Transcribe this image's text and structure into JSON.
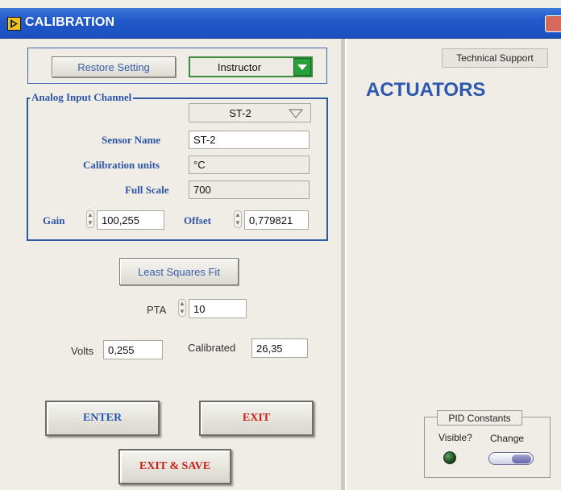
{
  "window": {
    "title": "CALIBRATION"
  },
  "top_bar": {
    "restore_label": "Restore Setting",
    "role_value": "Instructor"
  },
  "analog_group": {
    "title": "Analog Input Channel",
    "channel_value": "ST-2",
    "sensor_name_label": "Sensor Name",
    "sensor_name_value": "ST-2",
    "calib_units_label": "Calibration units",
    "calib_units_value": "°C",
    "full_scale_label": "Full Scale",
    "full_scale_value": "700",
    "gain_label": "Gain",
    "gain_value": "100,255",
    "offset_label": "Offset",
    "offset_value": "0,779821"
  },
  "lsq": {
    "button_label": "Least Squares  Fit"
  },
  "pta": {
    "label": "PTA",
    "value": "10"
  },
  "readings": {
    "volts_label": "Volts",
    "volts_value": "0,255",
    "calibrated_label": "Calibrated",
    "calibrated_value": "26,35"
  },
  "actions": {
    "enter_label": "ENTER",
    "exit_label": "EXIT",
    "exit_save_label": "EXIT & SAVE"
  },
  "right_panel": {
    "tech_support_label": "Technical Support",
    "heading": "ACTUATORS",
    "pid_title": "PID Constants",
    "visible_label": "Visible?",
    "change_label": "Change"
  },
  "colors": {
    "accent_blue": "#2c58b0",
    "exit_red": "#cc1f1a",
    "titlebar": "#2259c9"
  }
}
